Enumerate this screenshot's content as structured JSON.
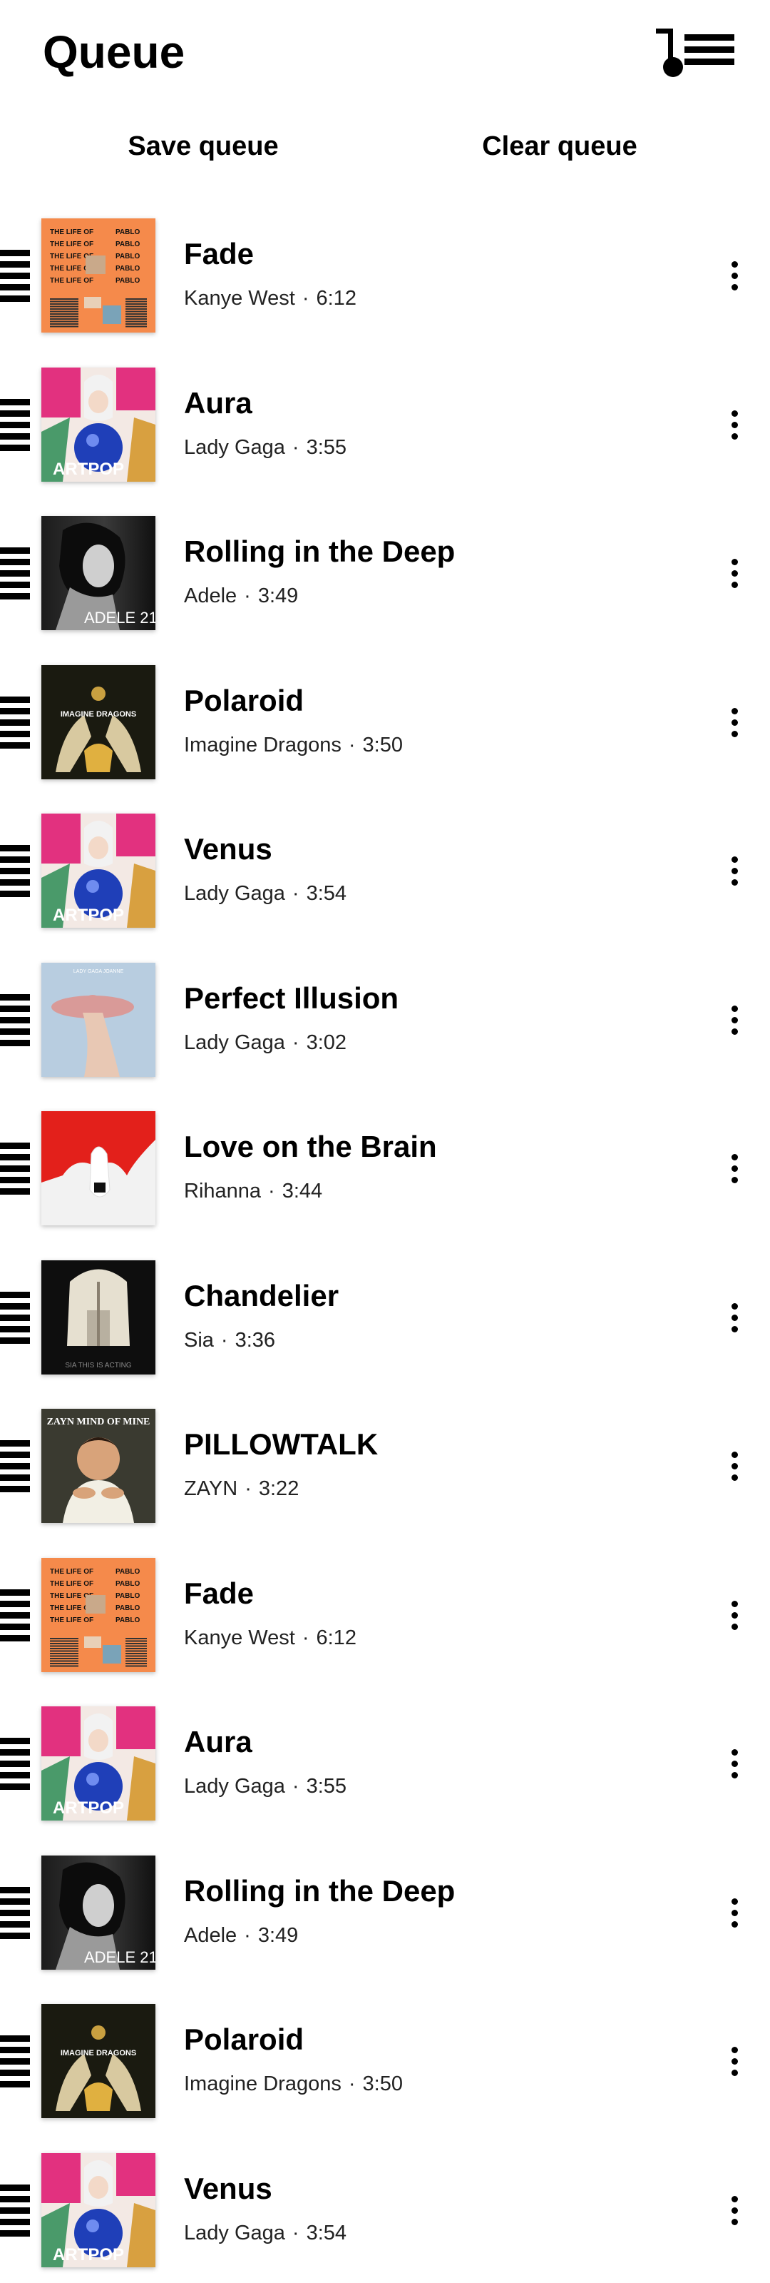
{
  "header": {
    "title": "Queue",
    "icon": "queue-list-icon"
  },
  "actions": {
    "save_label": "Save queue",
    "clear_label": "Clear queue"
  },
  "queue": [
    {
      "title": "Fade",
      "artist": "Kanye West",
      "duration": "6:12",
      "cover": "pablo"
    },
    {
      "title": "Aura",
      "artist": "Lady Gaga",
      "duration": "3:55",
      "cover": "artpop"
    },
    {
      "title": "Rolling in the Deep",
      "artist": "Adele",
      "duration": "3:49",
      "cover": "adele21"
    },
    {
      "title": "Polaroid",
      "artist": "Imagine Dragons",
      "duration": "3:50",
      "cover": "dragons"
    },
    {
      "title": "Venus",
      "artist": "Lady Gaga",
      "duration": "3:54",
      "cover": "artpop"
    },
    {
      "title": "Perfect Illusion",
      "artist": "Lady Gaga",
      "duration": "3:02",
      "cover": "joanne"
    },
    {
      "title": "Love on the Brain",
      "artist": "Rihanna",
      "duration": "3:44",
      "cover": "anti"
    },
    {
      "title": "Chandelier",
      "artist": "Sia",
      "duration": "3:36",
      "cover": "sia"
    },
    {
      "title": "PILLOWTALK",
      "artist": "ZAYN",
      "duration": "3:22",
      "cover": "zayn"
    },
    {
      "title": "Fade",
      "artist": "Kanye West",
      "duration": "6:12",
      "cover": "pablo"
    },
    {
      "title": "Aura",
      "artist": "Lady Gaga",
      "duration": "3:55",
      "cover": "artpop"
    },
    {
      "title": "Rolling in the Deep",
      "artist": "Adele",
      "duration": "3:49",
      "cover": "adele21"
    },
    {
      "title": "Polaroid",
      "artist": "Imagine Dragons",
      "duration": "3:50",
      "cover": "dragons"
    },
    {
      "title": "Venus",
      "artist": "Lady Gaga",
      "duration": "3:54",
      "cover": "artpop"
    }
  ],
  "meta_separator": "·",
  "covers": {
    "pablo": {
      "text": "THE LIFE OF PABLO",
      "bg": "#f58a4b"
    },
    "artpop": {
      "text": "ARTPOP",
      "bg": "#e2317f"
    },
    "adele21": {
      "text": "ADELE 21",
      "bg": "#2a2a2a"
    },
    "dragons": {
      "text": "IMAGINE DRAGONS",
      "bg": "#1a1a10"
    },
    "joanne": {
      "text": "LADY GAGA JOANNE",
      "bg": "#b8cde0"
    },
    "anti": {
      "text": "",
      "bg": "#e3201b"
    },
    "sia": {
      "text": "SIA THIS IS ACTING",
      "bg": "#0e0e0e"
    },
    "zayn": {
      "text": "ZAYN MIND OF MINE",
      "bg": "#3a3a30"
    }
  }
}
